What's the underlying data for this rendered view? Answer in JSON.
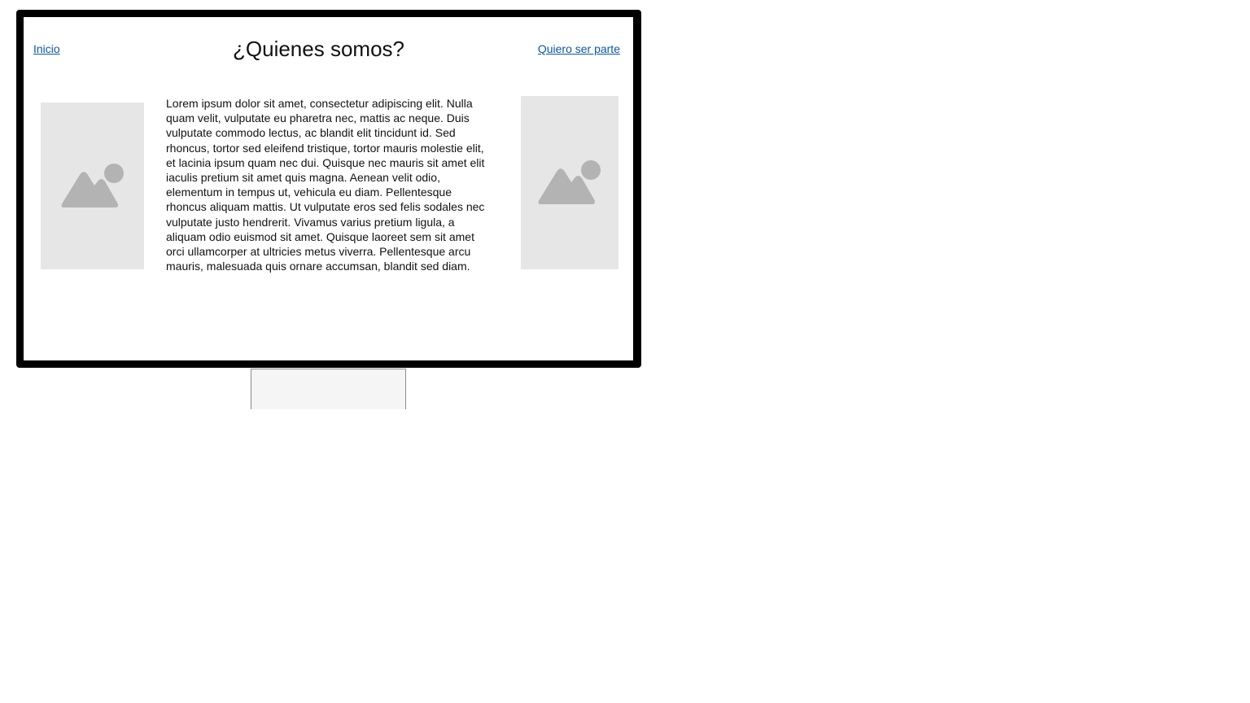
{
  "colors": {
    "frame": "#000000",
    "link": "#0b57a4",
    "placeholder_bg": "#e6e6e6",
    "placeholder_icon": "#b3b3b3",
    "stand_bg": "#f6f5f5"
  },
  "nav": {
    "home_label": "Inicio",
    "join_label": "Quiero ser parte"
  },
  "page": {
    "title": "¿Quienes somos?",
    "body": "Lorem ipsum dolor sit amet, consectetur adipiscing elit. Nulla quam velit, vulputate eu pharetra nec, mattis ac neque. Duis vulputate commodo lectus, ac blandit elit tincidunt id. Sed rhoncus, tortor sed eleifend tristique, tortor mauris molestie elit, et lacinia ipsum quam nec dui. Quisque nec mauris sit amet elit iaculis pretium sit amet quis magna. Aenean velit odio, elementum in tempus ut, vehicula eu diam. Pellentesque rhoncus aliquam mattis. Ut vulputate eros sed felis sodales nec vulputate justo hendrerit. Vivamus varius pretium ligula, a aliquam odio euismod sit amet. Quisque laoreet sem sit amet orci ullamcorper at ultricies metus viverra. Pellentesque arcu mauris, malesuada quis ornare accumsan, blandit sed diam."
  },
  "images": {
    "left_icon": "image-placeholder-icon",
    "right_icon": "image-placeholder-icon"
  }
}
